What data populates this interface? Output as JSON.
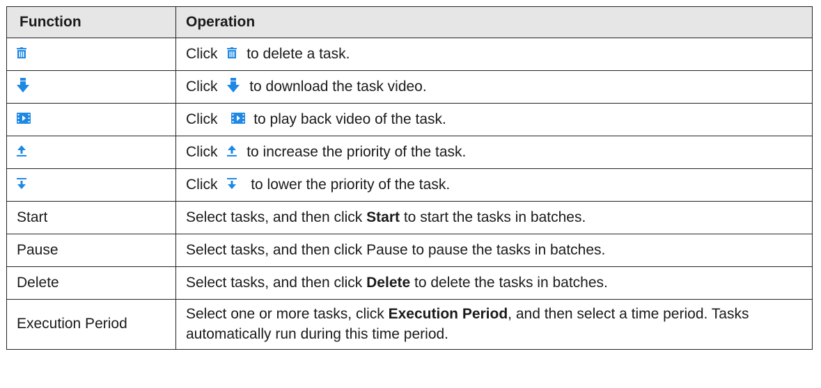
{
  "table": {
    "header": {
      "function": "Function",
      "operation": "Operation"
    },
    "rows": [
      {
        "function_icon": "delete-icon",
        "op_pre": "Click",
        "op_icon": "delete-icon",
        "op_post": "to delete a task."
      },
      {
        "function_icon": "download-icon",
        "op_pre": "Click",
        "op_icon": "download-icon",
        "op_post": "to download the task video."
      },
      {
        "function_icon": "playback-icon",
        "op_pre": "Click",
        "op_icon": "playback-icon",
        "op_post": "to play back video of the task."
      },
      {
        "function_icon": "increase-priority-icon",
        "op_pre": "Click",
        "op_icon": "increase-priority-icon",
        "op_post": "to increase the priority of the task."
      },
      {
        "function_icon": "lower-priority-icon",
        "op_pre": "Click",
        "op_icon": "lower-priority-icon",
        "op_post": "to lower the priority of the task."
      },
      {
        "function": "Start",
        "op_pre": "Select tasks, and then click",
        "op_bold": "Start",
        "op_post": "to start the tasks in batches."
      },
      {
        "function": "Pause",
        "op_text": "Select tasks, and then click Pause to pause the tasks in batches."
      },
      {
        "function": "Delete",
        "op_pre": "Select tasks, and then click",
        "op_bold": "Delete",
        "op_post": "to delete the tasks in batches."
      },
      {
        "function": "Execution Period",
        "op_pre": "Select one or more tasks, click",
        "op_bold": "Execution Period",
        "op_post": ", and then select a time period. Tasks automatically run during this time period."
      }
    ]
  },
  "colors": {
    "header_bg": "#e6e6e6",
    "icon_blue": "#1e88e5",
    "border": "#222222"
  }
}
